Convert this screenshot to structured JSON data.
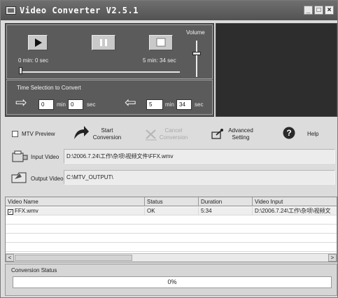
{
  "window": {
    "title": "Video Converter V2.5.1",
    "minimize_label": "_",
    "maximize_label": "□",
    "close_label": "×"
  },
  "player": {
    "play_icon": "play-icon",
    "pause_icon": "pause-icon",
    "stop_icon": "stop-icon",
    "current_time": "0 min: 0 sec",
    "total_time": "5 min: 34 sec",
    "seek_position": 0,
    "volume_label": "Volume",
    "volume_level": 0.7
  },
  "time_selection": {
    "label": "Time Selection to Convert",
    "start_min": "0",
    "start_sec": "0",
    "end_min": "5",
    "end_sec": "34",
    "min_unit": "min",
    "sec_unit": "sec"
  },
  "toolbar": {
    "mtv_preview": "MTV Preview",
    "mtv_checked": false,
    "start_line1": "Start",
    "start_line2": "Conversion",
    "cancel_line1": "Cancel",
    "cancel_line2": "Conversion",
    "advanced_line1": "Advanced",
    "advanced_line2": "Setting",
    "help": "Help"
  },
  "paths": {
    "input_label": "Input Video",
    "input_value": "D:\\2006.7.24\\工作\\杂项\\视频文件\\FFX.wmv",
    "output_label": "Output Video",
    "output_value": "C:\\MTV_OUTPUT\\"
  },
  "table": {
    "columns": [
      "Video Name",
      "Status",
      "Duration",
      "Video Input"
    ],
    "rows": [
      {
        "checked": true,
        "name": "FFX.wmv",
        "status": "OK",
        "duration": "5:34",
        "input": "D:\\2006.7.24\\工作\\杂项\\视频文"
      }
    ],
    "scroll_left": "<",
    "scroll_right": ">"
  },
  "status": {
    "label": "Conversion Status",
    "progress_text": "0%",
    "progress": 0
  }
}
